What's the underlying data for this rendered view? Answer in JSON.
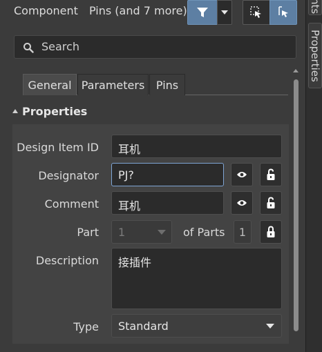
{
  "header": {
    "object_type": "Component",
    "filter_summary": "Pins (and 7 more)"
  },
  "search": {
    "placeholder": "Search"
  },
  "tabs": [
    {
      "label": "General",
      "active": true
    },
    {
      "label": "Parameters",
      "active": false
    },
    {
      "label": "Pins",
      "active": false
    }
  ],
  "section": {
    "title": "Properties"
  },
  "properties": {
    "design_item_id": {
      "label": "Design Item ID",
      "value": "耳机"
    },
    "designator": {
      "label": "Designator",
      "value": "PJ?"
    },
    "comment": {
      "label": "Comment",
      "value": "耳机"
    },
    "part": {
      "label": "Part",
      "value": "1",
      "of_parts_label": "of Parts",
      "of_parts_value": "1"
    },
    "description": {
      "label": "Description",
      "value": "接插件"
    },
    "type": {
      "label": "Type",
      "value": "Standard"
    }
  },
  "side_tabs": [
    {
      "label": "nts"
    },
    {
      "label": "Properties"
    }
  ],
  "colors": {
    "accent": "#5d7fa3",
    "background": "#3b3b3b",
    "field_bg": "#2b2b2b",
    "focus_border": "#7fa6d6"
  }
}
